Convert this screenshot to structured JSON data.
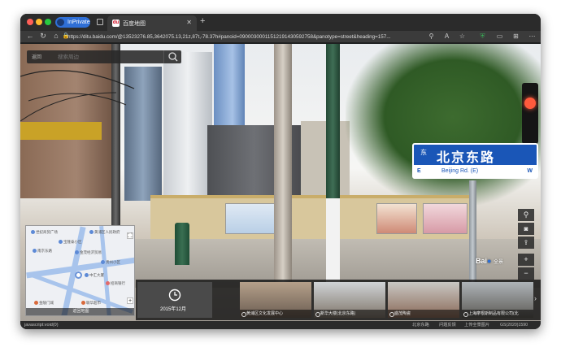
{
  "browser": {
    "inprivate_label": "InPrivate",
    "tab_title": "百度地图",
    "tab_favicon": "du",
    "url": "https://ditu.baidu.com/@13523276.85,3642075.13,21z,87t,-78.37h#panoid=09000300011512191430592758&panotype=street&heading=157..."
  },
  "search": {
    "back_label": "返回",
    "placeholder": "搜索周边"
  },
  "street_sign": {
    "left_char": "东",
    "chinese": "北京东路",
    "english_left": "E",
    "english_name": "Beijing Rd. (E)",
    "english_right": "W"
  },
  "minimap": {
    "pois": [
      "世纪商贸广场",
      "黄浦区人民政府",
      "宝隆泰小区",
      "南京东路",
      "金茂经济贸易",
      "贵州小区",
      "中汇大厦",
      "招商银行",
      "金陵门城",
      "联华超市"
    ],
    "footer_label": "返回地图"
  },
  "filmstrip": {
    "date_label": "2015年12月",
    "thumbs": [
      {
        "caption": "黄浦区文化发展中心"
      },
      {
        "caption": "新华大楼(北京东路)"
      },
      {
        "caption": "盛茂陶瓷"
      },
      {
        "caption": "上海摩根斯制品有限公司(北"
      }
    ]
  },
  "watermark": {
    "logo": "Bai",
    "suffix": "全景"
  },
  "status_bar": {
    "left": "javascript:void(0)",
    "links": [
      "北京东路",
      "问题反馈",
      "上传全景图片"
    ],
    "copyright": "GS(2020)1590"
  },
  "colors": {
    "sign_blue": "#1a56b7",
    "inprivate_blue": "#2f6fd6",
    "map_road": "#a8c4ec"
  }
}
